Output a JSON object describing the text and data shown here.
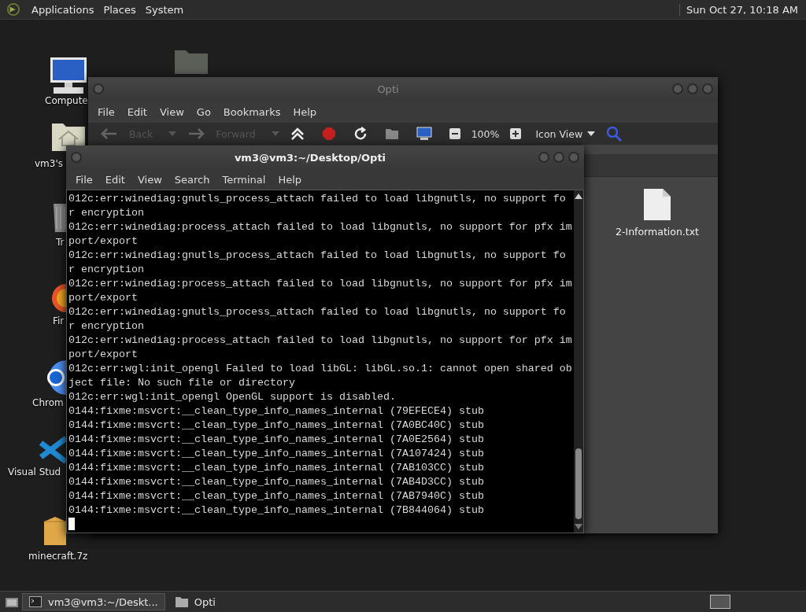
{
  "top_panel": {
    "menus": [
      "Applications",
      "Places",
      "System"
    ],
    "clock": "Sun Oct 27, 10:18 AM"
  },
  "desktop_icons": [
    {
      "kind": "computer",
      "label": "Compute"
    },
    {
      "kind": "folder"
    },
    {
      "kind": "home",
      "label": "vm3's"
    },
    {
      "kind": "trash",
      "label": "Tr"
    },
    {
      "kind": "firefox",
      "label": "Fir"
    },
    {
      "kind": "chrome",
      "label": "Chrom"
    },
    {
      "kind": "vscode",
      "label": "Visual Stud"
    },
    {
      "kind": "archive",
      "label": "minecraft.7z"
    }
  ],
  "file_manager": {
    "title": "Opti",
    "menu": [
      "File",
      "Edit",
      "View",
      "Go",
      "Bookmarks",
      "Help"
    ],
    "toolbar": {
      "back": "Back",
      "forward": "Forward",
      "zoom": "100%",
      "view": "Icon View"
    },
    "files": [
      {
        "name": "2-Information.txt"
      }
    ]
  },
  "terminal": {
    "title": "vm3@vm3:~/Desktop/Opti",
    "menu": [
      "File",
      "Edit",
      "View",
      "Search",
      "Terminal",
      "Help"
    ],
    "lines": [
      "012c:err:winediag:gnutls_process_attach failed to load libgnutls, no support for encryption",
      "012c:err:winediag:process_attach failed to load libgnutls, no support for pfx import/export",
      "012c:err:winediag:gnutls_process_attach failed to load libgnutls, no support for encryption",
      "012c:err:winediag:process_attach failed to load libgnutls, no support for pfx import/export",
      "012c:err:winediag:gnutls_process_attach failed to load libgnutls, no support for encryption",
      "012c:err:winediag:process_attach failed to load libgnutls, no support for pfx import/export",
      "012c:err:wgl:init_opengl Failed to load libGL: libGL.so.1: cannot open shared object file: No such file or directory",
      "012c:err:wgl:init_opengl OpenGL support is disabled.",
      "0144:fixme:msvcrt:__clean_type_info_names_internal (79EFECE4) stub",
      "0144:fixme:msvcrt:__clean_type_info_names_internal (7A0BC40C) stub",
      "0144:fixme:msvcrt:__clean_type_info_names_internal (7A0E2564) stub",
      "0144:fixme:msvcrt:__clean_type_info_names_internal (7A107424) stub",
      "0144:fixme:msvcrt:__clean_type_info_names_internal (7AB103CC) stub",
      "0144:fixme:msvcrt:__clean_type_info_names_internal (7AB4D3CC) stub",
      "0144:fixme:msvcrt:__clean_type_info_names_internal (7AB7940C) stub",
      "0144:fixme:msvcrt:__clean_type_info_names_internal (7B844064) stub"
    ]
  },
  "taskbar": {
    "items": [
      {
        "kind": "terminal",
        "label": "vm3@vm3:~/Deskt...",
        "selected": true
      },
      {
        "kind": "folder",
        "label": "Opti",
        "selected": false
      }
    ]
  }
}
